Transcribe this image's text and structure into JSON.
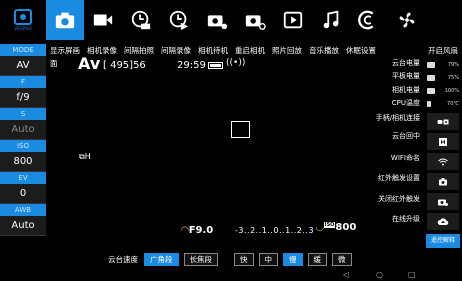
{
  "top_bar": {
    "icons": [
      "camera-icon",
      "video-icon",
      "timelapse-icon",
      "long-exposure-icon",
      "camera-standby-icon",
      "camera-restart-icon",
      "playback-icon",
      "music-icon",
      "infrared-icon",
      "fan-icon"
    ],
    "accent_color": "#1a8be0"
  },
  "left_panel": {
    "mode_label": "MODE",
    "mode_value": "AV",
    "f_label": "F",
    "f_value": "f/9",
    "s_label": "S",
    "s_value": "Auto",
    "iso_label": "ISO",
    "iso_value": "800",
    "ev_label": "EV",
    "ev_value": "0",
    "awb_label": "AWB",
    "awb_value": "Auto"
  },
  "menu": {
    "items": [
      "显示屏画",
      "相机录像",
      "间隔拍照",
      "间隔录像",
      "相机待机",
      "重启相机",
      "照片回放",
      "音乐播放",
      "休眠设置"
    ],
    "continued": "面"
  },
  "viewfinder": {
    "mode": "Av",
    "shots": "[ 495]56",
    "timer": "29:59",
    "drive": "H",
    "fnumber": "F9.0",
    "exposure_scale": "-3..2..1..0..1..2..3",
    "iso_tag": "ISO",
    "iso": "800"
  },
  "right_column": {
    "items": [
      "云台电量",
      "平板电量",
      "相机电量",
      "CPU温度",
      "手柄/相机连接",
      "云台回中",
      "WIFI命名",
      "红外触发设置",
      "关闭红外触发",
      "在线升级"
    ]
  },
  "right_panel": {
    "title": "开启风扇",
    "status_values": [
      "79%",
      "75%",
      "100%",
      "70℃"
    ],
    "blue_button": "遥控解释"
  },
  "bottom_bar": {
    "speed_label": "云台速度",
    "lens_buttons": [
      "广角段",
      "长焦段"
    ],
    "speed_buttons": [
      "快",
      "中",
      "慢",
      "缓",
      "微"
    ],
    "selected_lens": "广角段",
    "selected_speed": "慢"
  },
  "nav": {
    "back": "◁",
    "home": "○",
    "recent": "□"
  }
}
